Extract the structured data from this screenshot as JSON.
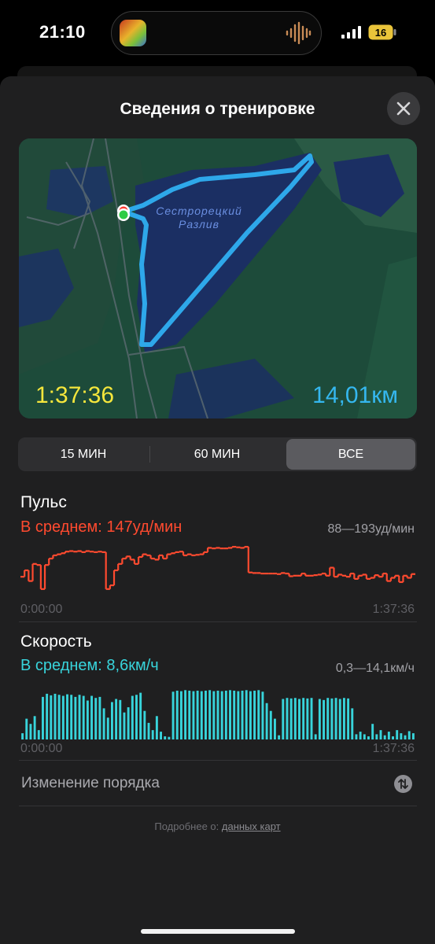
{
  "status_bar": {
    "time": "21:10",
    "battery_level": "16",
    "icons": [
      "music-app-thumbnail-icon",
      "waveform-icon",
      "cellular-signal-icon",
      "battery-icon"
    ]
  },
  "sheet": {
    "title": "Сведения о тренировке",
    "close_icon": "close-icon"
  },
  "map": {
    "place_label_line1": "Сестрорецкий",
    "place_label_line2": "Разлив",
    "duration": "1:37:36",
    "distance": "14,01км",
    "colors": {
      "route": "#35b7ef",
      "duration": "#f5e63c",
      "distance": "#35b7ef"
    }
  },
  "segments": {
    "items": [
      "15 МИН",
      "60 МИН",
      "ВСЕ"
    ],
    "selected": "ВСЕ"
  },
  "heart_rate": {
    "title": "Пульс",
    "average": "В среднем: 147уд/мин",
    "range": "88—193уд/мин",
    "start_time": "0:00:00",
    "end_time": "1:37:36",
    "color": "#ff4a2f",
    "samples": [
      0.38,
      0.5,
      0.3,
      0.62,
      0.6,
      0.15,
      0.6,
      0.72,
      0.78,
      0.8,
      0.82,
      0.85,
      0.86,
      0.85,
      0.86,
      0.84,
      0.86,
      0.85,
      0.84,
      0.85,
      0.84,
      0.15,
      0.22,
      0.5,
      0.62,
      0.72,
      0.76,
      0.7,
      0.62,
      0.75,
      0.8,
      0.78,
      0.72,
      0.7,
      0.78,
      0.72,
      0.8,
      0.82,
      0.84,
      0.85,
      0.78,
      0.8,
      0.78,
      0.79,
      0.8,
      0.84,
      0.92,
      0.91,
      0.92,
      0.91,
      0.91,
      0.92,
      0.94,
      0.93,
      0.92,
      0.94,
      0.46,
      0.45,
      0.45,
      0.44,
      0.44,
      0.44,
      0.44,
      0.43,
      0.45,
      0.44,
      0.39,
      0.4,
      0.4,
      0.44,
      0.4,
      0.4,
      0.41,
      0.42,
      0.44,
      0.4,
      0.55,
      0.38,
      0.42,
      0.4,
      0.38,
      0.44,
      0.34,
      0.4,
      0.42,
      0.34,
      0.36,
      0.41,
      0.38,
      0.44,
      0.3,
      0.36,
      0.4,
      0.28,
      0.4,
      0.36,
      0.43
    ]
  },
  "speed": {
    "title": "Скорость",
    "average": "В среднем: 8,6км/ч",
    "range": "0,3—14,1км/ч",
    "start_time": "0:00:00",
    "end_time": "1:37:36",
    "color": "#38d4db",
    "samples": [
      0.12,
      0.4,
      0.3,
      0.45,
      0.18,
      0.82,
      0.88,
      0.85,
      0.88,
      0.86,
      0.84,
      0.87,
      0.86,
      0.82,
      0.86,
      0.84,
      0.75,
      0.84,
      0.8,
      0.82,
      0.6,
      0.42,
      0.72,
      0.78,
      0.76,
      0.52,
      0.62,
      0.84,
      0.86,
      0.9,
      0.55,
      0.32,
      0.18,
      0.45,
      0.15,
      0.06,
      0.05,
      0.92,
      0.94,
      0.93,
      0.95,
      0.94,
      0.93,
      0.94,
      0.93,
      0.94,
      0.95,
      0.93,
      0.94,
      0.93,
      0.94,
      0.95,
      0.94,
      0.93,
      0.94,
      0.95,
      0.93,
      0.94,
      0.95,
      0.92,
      0.7,
      0.55,
      0.4,
      0.08,
      0.78,
      0.8,
      0.79,
      0.8,
      0.78,
      0.8,
      0.79,
      0.8,
      0.1,
      0.78,
      0.76,
      0.8,
      0.79,
      0.8,
      0.78,
      0.8,
      0.79,
      0.6,
      0.1,
      0.15,
      0.1,
      0.06,
      0.3,
      0.1,
      0.18,
      0.08,
      0.15,
      0.06,
      0.18,
      0.12,
      0.08,
      0.16,
      0.12
    ]
  },
  "reorder": {
    "label": "Изменение порядка",
    "icon": "reorder-arrows-icon"
  },
  "footer": {
    "prefix": "Подробнее о:",
    "link": "данных карт"
  }
}
